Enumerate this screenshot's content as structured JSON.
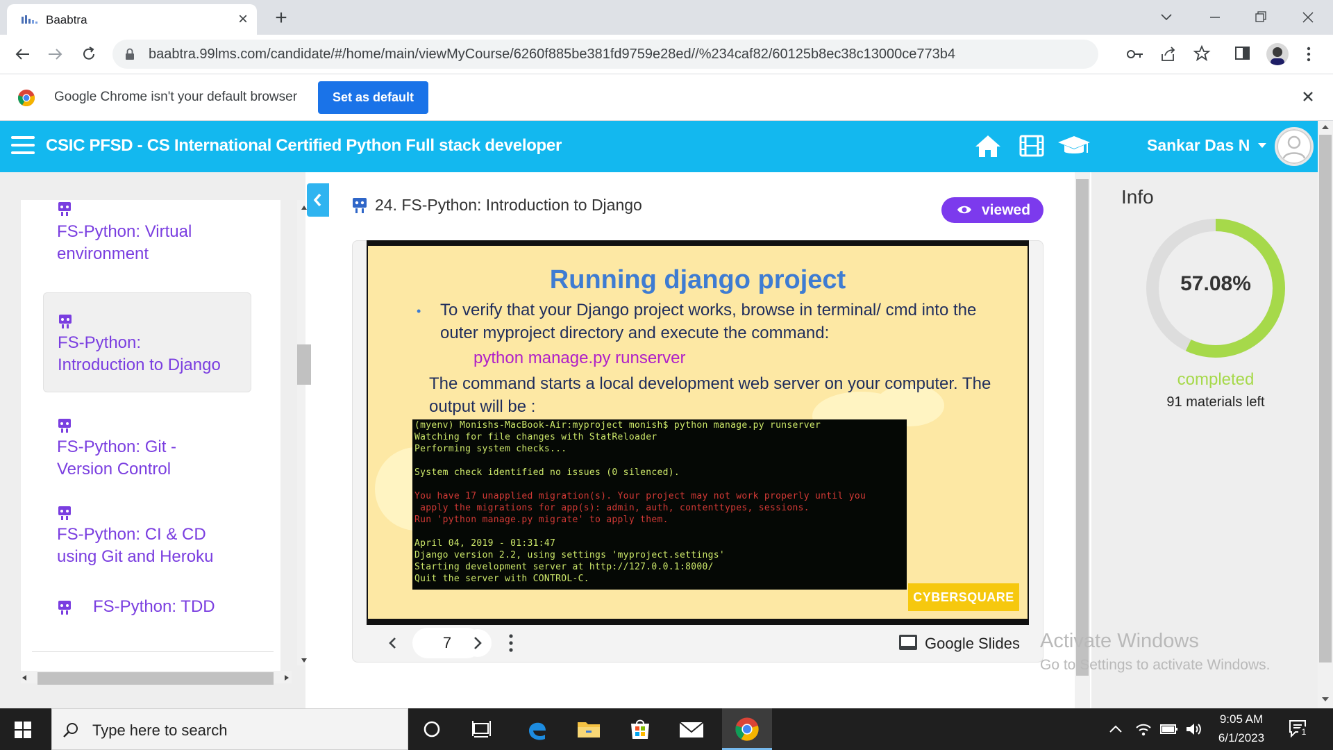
{
  "browser": {
    "tab_title": "Baabtra",
    "url": "baabtra.99lms.com/candidate/#/home/main/viewMyCourse/6260f885be381fd9759e28ed//%234caf82/60125b8ec38c13000ce773b4",
    "infobar_text": "Google Chrome isn't your default browser",
    "set_default_label": "Set as default"
  },
  "header": {
    "course_title": "CSIC PFSD - CS International Certified Python Full stack developer",
    "user_name": "Sankar Das N",
    "icons": [
      "home-icon",
      "film-icon",
      "graduation-cap-icon"
    ],
    "brand_color": "#13b8ef"
  },
  "sidebar": {
    "items": [
      {
        "label_lines": [
          "FS-Python: Virtual",
          "environment"
        ],
        "icon": "slides-icon"
      },
      {
        "label_lines": [
          "FS-Python:",
          "Introduction to Django"
        ],
        "icon": "slides-icon",
        "active": true
      },
      {
        "label_lines": [
          "FS-Python: Git -",
          "Version Control"
        ],
        "icon": "slides-icon"
      },
      {
        "label_lines": [
          "FS-Python: CI & CD",
          "using Git and Heroku"
        ],
        "icon": "slides-icon"
      },
      {
        "label_lines": [
          "FS-Python: TDD"
        ],
        "icon": "slides-icon"
      }
    ]
  },
  "lesson": {
    "title": "24. FS-Python: Introduction to Django",
    "badge": "viewed"
  },
  "slide": {
    "title": "Running django project",
    "bullet_lines": [
      "To verify that your Django project works, browse in terminal/ cmd into the",
      "outer myproject directory and execute the command:"
    ],
    "command": "python manage.py runserver",
    "para_lines": [
      "The command starts a local development web server on your computer. The",
      "output will be :"
    ],
    "terminal_lines": [
      {
        "text": "(myenv) Monishs-MacBook-Air:myproject monish$ python manage.py runserver",
        "color": "green"
      },
      {
        "text": "Watching for file changes with StatReloader",
        "color": "green"
      },
      {
        "text": "Performing system checks...",
        "color": "green"
      },
      {
        "text": "",
        "color": "blank"
      },
      {
        "text": "System check identified no issues (0 silenced).",
        "color": "green"
      },
      {
        "text": "",
        "color": "blank"
      },
      {
        "text": "You have 17 unapplied migration(s). Your project may not work properly until you",
        "color": "red"
      },
      {
        "text": " apply the migrations for app(s): admin, auth, contenttypes, sessions.",
        "color": "red"
      },
      {
        "text": "Run 'python manage.py migrate' to apply them.",
        "color": "red"
      },
      {
        "text": "",
        "color": "blank"
      },
      {
        "text": "April 04, 2019 - 01:31:47",
        "color": "green"
      },
      {
        "text": "Django version 2.2, using settings 'myproject.settings'",
        "color": "green"
      },
      {
        "text": "Starting development server at http://127.0.0.1:8000/",
        "color": "green"
      },
      {
        "text": "Quit the server with CONTROL-C.",
        "color": "green"
      }
    ],
    "logo_text": "CYBERSQUARE",
    "page": "7",
    "provider_label": "Google Slides"
  },
  "info": {
    "title": "Info",
    "progress_percent": 57.08,
    "progress_text": "57.08%",
    "completed_label": "completed",
    "materials_left": "91 materials left",
    "ring_color": "#a6d94a",
    "ring_track_color": "#dddddd"
  },
  "watermark": {
    "title": "Activate Windows",
    "subtitle": "Go to Settings to activate Windows."
  },
  "taskbar": {
    "search_placeholder": "Type here to search",
    "time": "9:05 AM",
    "date": "6/1/2023",
    "notification_count": "1"
  }
}
